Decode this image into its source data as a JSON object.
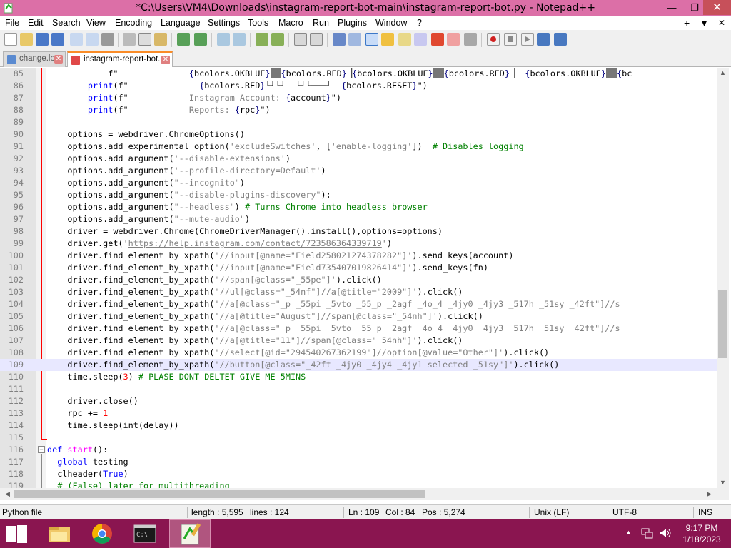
{
  "window": {
    "title": "*C:\\Users\\VM4\\Downloads\\instagram-report-bot-main\\instagram-report-bot.py - Notepad++",
    "minimize_glyph": "—",
    "maximize_glyph": "❐",
    "close_glyph": "✕"
  },
  "menu": {
    "items": [
      "File",
      "Edit",
      "Search",
      "View",
      "Encoding",
      "Language",
      "Settings",
      "Tools",
      "Macro",
      "Run",
      "Plugins",
      "Window",
      "?"
    ],
    "right_plus": "+",
    "right_dropdown": "▾",
    "right_close": "✕"
  },
  "toolbar": {
    "icons": [
      "new-file-icon",
      "open-file-icon",
      "save-icon",
      "save-all-icon",
      "close-icon",
      "close-all-icon",
      "print-icon",
      "cut-icon",
      "copy-icon",
      "paste-icon",
      "undo-icon",
      "redo-icon",
      "find-icon",
      "replace-icon",
      "zoom-in-icon",
      "zoom-out-icon",
      "sync-vertical-icon",
      "sync-horizontal-icon",
      "word-wrap-icon",
      "show-all-chars-icon",
      "indent-guide-icon",
      "user-defined-language-icon",
      "document-map-icon",
      "function-list-icon",
      "folder-as-workspace-icon",
      "monitoring-icon",
      "record-macro-icon",
      "stop-recording-icon",
      "playback-macro-icon",
      "run-macro-multiple-icon",
      "save-macro-icon"
    ]
  },
  "tabs": [
    {
      "label": "change.log",
      "close": "✕",
      "active": false
    },
    {
      "label": "instagram-report-bot.py",
      "close": "✕",
      "active": true
    }
  ],
  "editor": {
    "current_line": 109,
    "lines": [
      {
        "n": "85",
        "html": "            f\"              <span class='p'>{</span>bcolors.OKBLUE<span class='p'>}</span><span class='cursor-box'></span><span class='p'>{</span>bcolors.RED<span class='p'>}</span>▕<span class='p'>{</span>bcolors.OKBLUE<span class='p'>}</span><span class='cursor-box'></span><span class='p'>{</span>bcolors.RED<span class='p'>}</span>▕  <span class='p'>{</span>bcolors.OKBLUE<span class='p'>}</span><span class='cursor-box'></span><span class='p'>{</span>bc"
      },
      {
        "n": "86",
        "html": "        <span class='k'>print</span>(f\"              <span class='p'>{</span>bcolors.RED<span class='p'>}</span>└┘└┘  └┘└───┘  <span class='p'>{</span>bcolors.RESET<span class='p'>}</span>\")"
      },
      {
        "n": "87",
        "html": "        <span class='k'>print</span>(f\"            <span class='s'>Instagram Account: </span><span class='p'>{</span>account<span class='p'>}</span>\")"
      },
      {
        "n": "88",
        "html": "        <span class='k'>print</span>(f\"            <span class='s'>Reports: </span><span class='p'>{</span>rpc<span class='p'>}</span>\")"
      },
      {
        "n": "89",
        "html": ""
      },
      {
        "n": "90",
        "html": "    options = webdriver.ChromeOptions()"
      },
      {
        "n": "91",
        "html": "    options.add_experimental_option(<span class='s'>'excludeSwitches'</span>, [<span class='s'>'enable-logging'</span>])  <span class='c'># Disables logging</span>"
      },
      {
        "n": "92",
        "html": "    options.add_argument(<span class='s'>'--disable-extensions'</span>)"
      },
      {
        "n": "93",
        "html": "    options.add_argument(<span class='s'>'--profile-directory=Default'</span>)"
      },
      {
        "n": "94",
        "html": "    options.add_argument(<span class='s'>\"--incognito\"</span>)"
      },
      {
        "n": "95",
        "html": "    options.add_argument(<span class='s'>\"--disable-plugins-discovery\"</span>);"
      },
      {
        "n": "96",
        "html": "    options.add_argument(<span class='s'>\"--headless\"</span>) <span class='c'># Turns Chrome into headless browser</span>"
      },
      {
        "n": "97",
        "html": "    options.add_argument(<span class='s'>\"--mute-audio\"</span>)"
      },
      {
        "n": "98",
        "html": "    driver = webdriver.Chrome(ChromeDriverManager().install(),options=options)"
      },
      {
        "n": "99",
        "html": "    driver.get(<span class='s'>'<u>https://help.instagram.com/contact/723586364339719</u>'</span>)"
      },
      {
        "n": "100",
        "html": "    driver.find_element_by_xpath(<span class='s'>'//input[@name=\"Field258021274378282\"]'</span>).send_keys(account)"
      },
      {
        "n": "101",
        "html": "    driver.find_element_by_xpath(<span class='s'>'//input[@name=\"Field735407019826414\"]'</span>).send_keys(fn)"
      },
      {
        "n": "102",
        "html": "    driver.find_element_by_xpath(<span class='s'>'//span[@class=\"_55pe\"]'</span>).click()"
      },
      {
        "n": "103",
        "html": "    driver.find_element_by_xpath(<span class='s'>'//ul[@class=\"_54nf\"]//a[@title=\"2009\"]'</span>).click()"
      },
      {
        "n": "104",
        "html": "    driver.find_element_by_xpath(<span class='s'>'//a[@class=\"_p _55pi _5vto _55_p _2agf _4o_4 _4jy0 _4jy3 _517h _51sy _42ft\"]//s</span>"
      },
      {
        "n": "105",
        "html": "    driver.find_element_by_xpath(<span class='s'>'//a[@title=\"August\"]//span[@class=\"_54nh\"]'</span>).click()"
      },
      {
        "n": "106",
        "html": "    driver.find_element_by_xpath(<span class='s'>'//a[@class=\"_p _55pi _5vto _55_p _2agf _4o_4 _4jy0 _4jy3 _517h _51sy _42ft\"]//s</span>"
      },
      {
        "n": "107",
        "html": "    driver.find_element_by_xpath(<span class='s'>'//a[@title=\"11\"]//span[@class=\"_54nh\"]'</span>).click()"
      },
      {
        "n": "108",
        "html": "    driver.find_element_by_xpath(<span class='s'>'//select[@id=\"294540267362199\"]//option[@value=\"Other\"]'</span>).click()"
      },
      {
        "n": "109",
        "html": "    driver.find_element_by_xpath(<span class='s'>'//button[@class=\"_42ft _4jy0 _4jy4 _4jy1 selected _51sy\"]'</span>).click()"
      },
      {
        "n": "110",
        "html": "    time.sleep(<span class='n'>3</span>) <span class='c'># PLASE DONT DELTET GIVE ME 5MINS</span>"
      },
      {
        "n": "111",
        "html": ""
      },
      {
        "n": "112",
        "html": "    driver.close()"
      },
      {
        "n": "113",
        "html": "    rpc += <span class='n'>1</span>"
      },
      {
        "n": "114",
        "html": "    time.sleep(int(delay))"
      },
      {
        "n": "115",
        "html": ""
      },
      {
        "n": "116",
        "html": "<span class='k'>def</span> <span style='color:#ff00ff'>start</span>():"
      },
      {
        "n": "117",
        "html": "  <span class='k'>global</span> testing"
      },
      {
        "n": "118",
        "html": "  clheader(<span class='k'>True</span>)"
      },
      {
        "n": "119",
        "html": "  <span class='c'># (False) later for multithreading</span>"
      }
    ]
  },
  "status": {
    "file_type": "Python file",
    "length": "length : 5,595",
    "lines": "lines : 124",
    "ln": "Ln : 109",
    "col": "Col : 84",
    "pos": "Pos : 5,274",
    "eol": "Unix (LF)",
    "encoding": "UTF-8",
    "mode": "INS"
  },
  "taskbar": {
    "apps": [
      "file-explorer-icon",
      "chrome-icon",
      "command-prompt-icon",
      "notepad-plus-plus-icon"
    ],
    "tray_up": "▲",
    "time": "9:17 PM",
    "date": "1/18/2023"
  },
  "colors": {
    "titlebar": "#dc6fa7",
    "taskbar": "#8a1550",
    "active_tab_accent": "#fa8c28",
    "keyword": "#0000ff",
    "comment": "#008000",
    "string": "#808080",
    "number": "#ff0000"
  }
}
